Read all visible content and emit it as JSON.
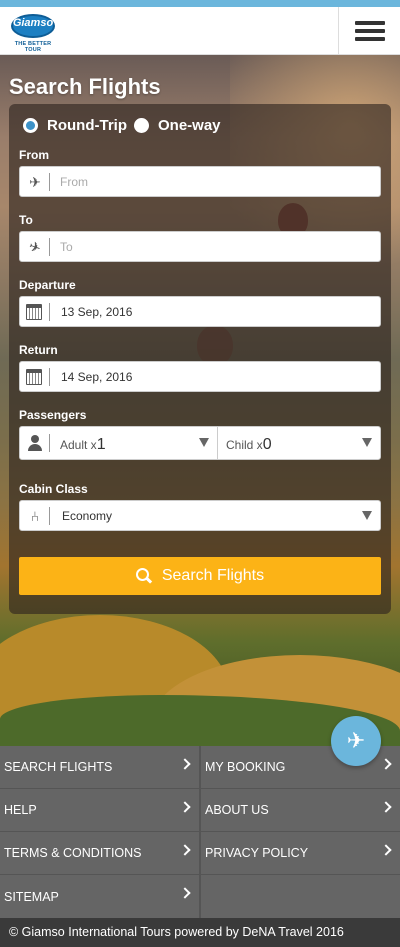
{
  "brand": {
    "logo_text": "Giamso",
    "tagline": "THE BETTER TOUR",
    "accent_color": "#6bb6dc",
    "cta_color": "#fcb316"
  },
  "header": {
    "menu_icon": "hamburger-menu-icon"
  },
  "search": {
    "title": "Search Flights",
    "trip_types": [
      {
        "label": "Round-Trip",
        "selected": true
      },
      {
        "label": "One-way",
        "selected": false
      }
    ],
    "from": {
      "label": "From",
      "placeholder": "From",
      "icon": "plane-takeoff-icon"
    },
    "to": {
      "label": "To",
      "placeholder": "To",
      "icon": "plane-landing-icon"
    },
    "departure": {
      "label": "Departure",
      "value": "13 Sep, 2016",
      "icon": "calendar-icon"
    },
    "return": {
      "label": "Return",
      "value": "14 Sep, 2016",
      "icon": "calendar-icon"
    },
    "passengers": {
      "label": "Passengers",
      "adult_label": "Adult x",
      "adult_value": "1",
      "child_label": "Child x",
      "child_value": "0"
    },
    "cabin": {
      "label": "Cabin Class",
      "value": "Economy",
      "icon": "seat-icon"
    },
    "submit_label": "Search Flights"
  },
  "footer_links": [
    {
      "label": "SEARCH FLIGHTS"
    },
    {
      "label": "MY BOOKING"
    },
    {
      "label": "HELP"
    },
    {
      "label": "ABOUT US"
    },
    {
      "label": "TERMS & CONDITIONS"
    },
    {
      "label": "PRIVACY POLICY"
    },
    {
      "label": "SITEMAP"
    }
  ],
  "footer": {
    "copyright": "© Giamso International Tours powered by DeNA Travel 2016"
  }
}
